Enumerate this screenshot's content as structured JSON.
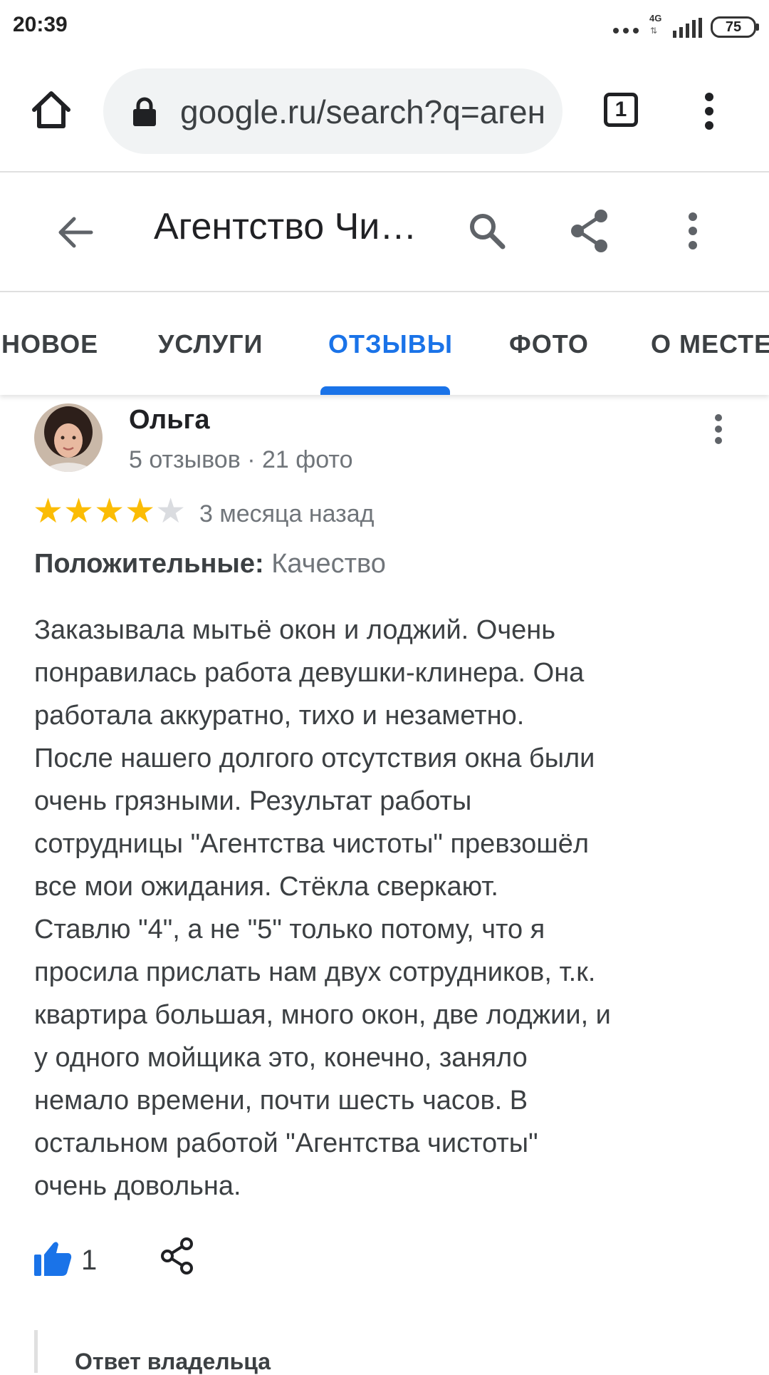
{
  "status_bar": {
    "time": "20:39",
    "network": "4G",
    "battery": "75"
  },
  "browser": {
    "url": "google.ru/search?q=агентство",
    "tab_count": "1"
  },
  "place": {
    "title": "Агентство Чистоты"
  },
  "tabs": [
    {
      "label": "НОВОЕ"
    },
    {
      "label": "УСЛУГИ"
    },
    {
      "label": "ОТЗЫВЫ"
    },
    {
      "label": "ФОТО"
    },
    {
      "label": "О МЕСТЕ"
    }
  ],
  "active_tab": "ОТЗЫВЫ",
  "review": {
    "author": "Ольга",
    "meta": "5 отзывов · 21 фото",
    "rating": 4,
    "rating_max": 5,
    "date": "3 месяца назад",
    "pros_label": "Положительные:",
    "pros_value": "Качество",
    "text_lines": [
      "Заказывала мытьё окон и лоджий. Очень",
      "понравилась работа девушки-клинера. Она",
      "работала аккуратно, тихо и незаметно.",
      "После нашего долгого отсутствия окна были",
      "очень грязными. Результат работы",
      "сотрудницы \"Агентства чистоты\" превзошёл",
      "все мои ожидания. Стёкла сверкают.",
      "Ставлю \"4\", а не \"5\" только потому, что я",
      "просила прислать нам двух сотрудников, т.к.",
      "квартира большая, много окон, две лоджии, и",
      "у одного мойщика это, конечно, заняло",
      "немало времени, почти шесть часов. В",
      "остальном работой \"Агентства чистоты\"",
      "очень довольна."
    ],
    "likes": "1"
  },
  "owner_reply": {
    "label": "Ответ владельца"
  },
  "colors": {
    "accent": "#1a73e8",
    "star_filled": "#fbbc04",
    "star_empty": "#dadce0",
    "text_secondary": "#70757a"
  },
  "icons": {
    "home": "home-icon",
    "lock": "lock-icon",
    "tabs": "tabs-counter-icon",
    "menu": "more-vert-icon",
    "back": "arrow-back-icon",
    "search": "search-icon",
    "share": "share-icon",
    "like": "thumbs-up-icon"
  }
}
